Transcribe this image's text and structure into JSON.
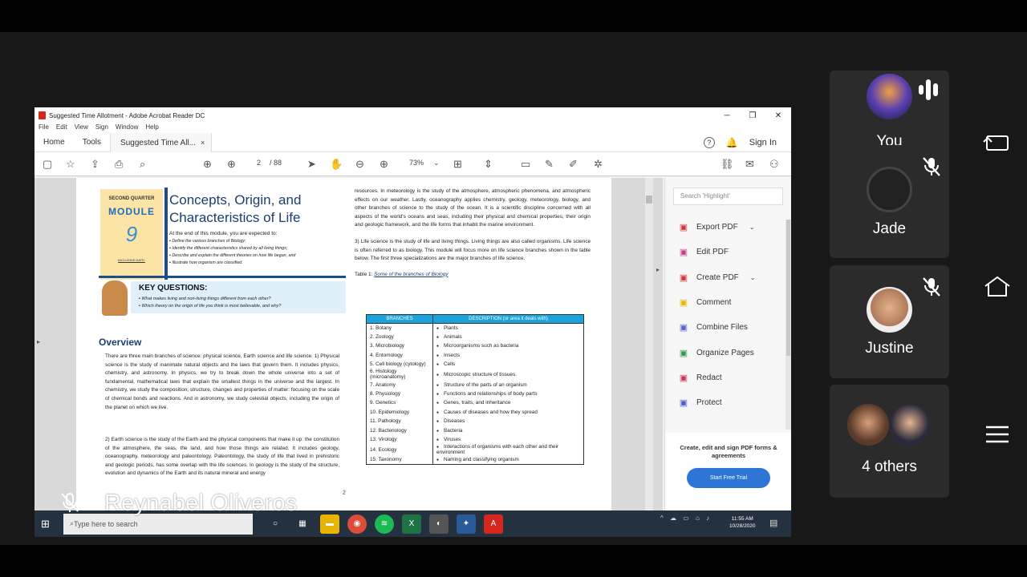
{
  "window": {
    "title": "Suggested Time Allotment - Adobe Acrobat Reader DC",
    "min": "─",
    "max": "❐",
    "close": "✕"
  },
  "menu": [
    "File",
    "Edit",
    "View",
    "Sign",
    "Window",
    "Help"
  ],
  "tabs": {
    "home": "Home",
    "tools": "Tools",
    "doc": "Suggested Time All...",
    "doc_close": "×",
    "signin": "Sign In"
  },
  "toolbar": {
    "page_current": "2",
    "page_total": "/ 88",
    "zoom": "73%"
  },
  "doc": {
    "badge": {
      "quarter": "SECOND QUARTER",
      "module": "MODULE",
      "number": "9",
      "date_label": "INCLUSIVE DATE:"
    },
    "title": "Concepts, Origin, and Characteristics of Life",
    "expect_intro": "At the end of this module, you are expected to:",
    "objectives": [
      "Define the various branches of Biology;",
      "Identify the different characteristics shared by all living things;",
      "Describe and explain the different theories on how life began, and",
      "Illustrate how organism are classified."
    ],
    "kq_title": "KEY QUESTIONS:",
    "kq": [
      "What makes living and non-living things different from each other?",
      "Which theory on the origin of life you think is most believable, and why?"
    ],
    "overview": "Overview",
    "p1": "There are three main branches of science: physical science, Earth science and life science. 1) Physical science is the study of inanimate natural objects and the laws that govern them. It includes physics, chemistry, and astronomy. In physics, we try to break down the whole universe into a set of fundamental, mathematical laws that explain the smallest things in the universe and the largest. In chemistry, we study the composition, structure, changes and properties of matter: focusing on the scale of chemical bonds and reactions. And in astronomy, we study celestial objects, including the origin of the planet on which we live.",
    "p2": "2) Earth science is the study of the Earth and the physical components that make it up: the constitution of the atmosphere, the seas, the land, and how those things are related. It includes geology, oceanography, meteorology and paleontology. Paleontology, the study of life that lived in prehistoric and geologic periods, has some overlap with the life sciences. In geology is the study of the structure, evolution and dynamics of the Earth and its natural mineral and energy",
    "r1": "resources. In meteorology is the study of the atmosphere, atmospheric phenomena, and atmospheric effects on our weather. Lastly, oceanography applies chemistry, geology, meteorology, biology, and other branches of science to the study of the ocean. It is a scientific discipline concerned with all aspects of the world's oceans and seas, including their physical and chemical properties, their origin and geologic framework, and the life forms that inhabit the marine environment.",
    "r2": "3) Life science is the study of life and living things. Living things are also called organisms. Life science is often referred to as biology. This module will focus more on life science branches shown in the table below. The first three specializations are the major branches of life science.",
    "table_caption_prefix": "Table 1:",
    "table_caption": "Some of the branches of Biology",
    "table_headers": [
      "BRANCHES",
      "DESCRIPTION (or area it deals with)"
    ],
    "table_rows": [
      [
        "1.  Botany",
        "Plants"
      ],
      [
        "2.  Zoology",
        "Animals"
      ],
      [
        "3.  Microbiology",
        "Microorganisms such as bacteria"
      ],
      [
        "4.  Entomology",
        "Insects"
      ],
      [
        "5.  Cell biology (cytology)",
        "Cells"
      ],
      [
        "6.  Histology (microanatomy)",
        "Microscopic structure of tissues."
      ],
      [
        "7.  Anatomy",
        "Structure of the parts of an organism"
      ],
      [
        "8.  Physiology",
        "Functions and relationships of body parts"
      ],
      [
        "9.  Genetics",
        "Genes, traits, and inheritance"
      ],
      [
        "10.  Epidemiology",
        "Causes of diseases and how they spread"
      ],
      [
        "11.  Pathology",
        "Diseases"
      ],
      [
        "12.  Bacteriology",
        "Bacteria"
      ],
      [
        "13.  Virology",
        "Viruses"
      ],
      [
        "14.  Ecology",
        "Interactions of organisms with each other and their environment"
      ],
      [
        "15.  Taxonomy",
        "Naming and classifying organism"
      ]
    ],
    "page_number": "2"
  },
  "tools_panel": {
    "search_placeholder": "Search 'Highlight'",
    "items": [
      {
        "label": "Export PDF",
        "icon": "export-pdf-icon",
        "chevron": "⌄",
        "color": "#d13b3b"
      },
      {
        "label": "Edit PDF",
        "icon": "edit-pdf-icon",
        "chevron": "",
        "color": "#c2408f"
      },
      {
        "label": "Create PDF",
        "icon": "create-pdf-icon",
        "chevron": "⌄",
        "color": "#d13b3b"
      },
      {
        "label": "Comment",
        "icon": "comment-icon",
        "chevron": "",
        "color": "#e0b800"
      },
      {
        "label": "Combine Files",
        "icon": "combine-files-icon",
        "chevron": "",
        "color": "#5a63c9"
      },
      {
        "label": "Organize Pages",
        "icon": "organize-pages-icon",
        "chevron": "",
        "color": "#2f9a4a"
      },
      {
        "label": "Redact",
        "icon": "redact-icon",
        "chevron": "",
        "color": "#c8365a"
      },
      {
        "label": "Protect",
        "icon": "protect-icon",
        "chevron": "",
        "color": "#4a5fc9"
      }
    ],
    "promo_text": "Create, edit and sign PDF forms & agreements",
    "promo_button": "Start Free Trial"
  },
  "taskbar": {
    "search": "Type here to search",
    "time": "11:55 AM",
    "date": "10/28/2020"
  },
  "presenter": {
    "name": "Reynabel Oliveros"
  },
  "participants": [
    {
      "name": "You",
      "muted": false
    },
    {
      "name": "Jade",
      "muted": true
    },
    {
      "name": "Justine",
      "muted": true
    },
    {
      "name": "4 others",
      "muted": false
    }
  ],
  "colors": {
    "accent": "#1ba3dd",
    "acrobat_red": "#d7261e",
    "trial_button": "#2d76d6",
    "title_blue": "#1b3e72"
  }
}
